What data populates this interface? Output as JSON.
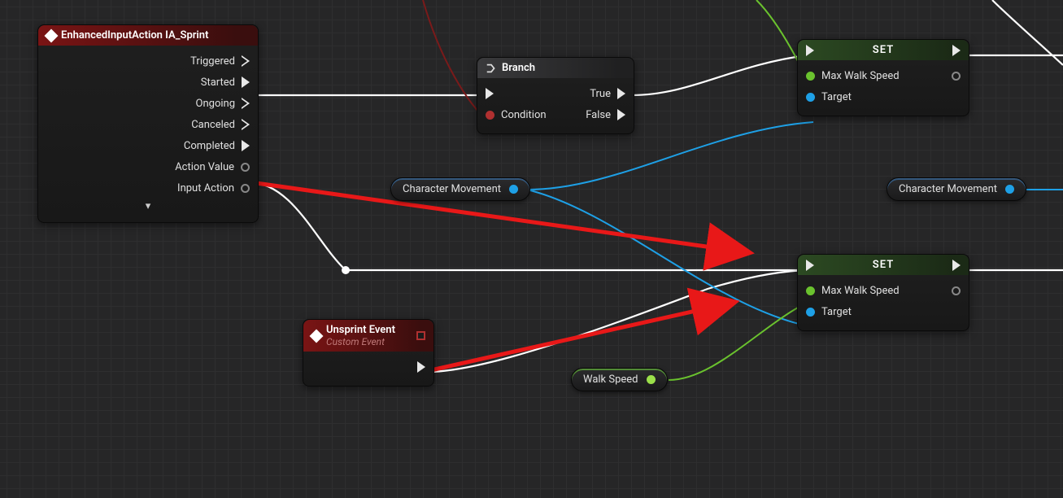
{
  "nodes": {
    "sprint": {
      "title": "EnhancedInputAction IA_Sprint",
      "pins": {
        "triggered": "Triggered",
        "started": "Started",
        "ongoing": "Ongoing",
        "canceled": "Canceled",
        "completed": "Completed",
        "action_value": "Action Value",
        "input_action": "Input Action"
      }
    },
    "branch": {
      "title": "Branch",
      "pins": {
        "condition": "Condition",
        "true": "True",
        "false": "False"
      }
    },
    "unsprint": {
      "title": "Unsprint Event",
      "subtitle": "Custom Event"
    },
    "set1": {
      "title": "SET",
      "pins": {
        "mws": "Max Walk Speed",
        "target": "Target"
      }
    },
    "set2": {
      "title": "SET",
      "pins": {
        "mws": "Max Walk Speed",
        "target": "Target"
      }
    },
    "charmove1": {
      "label": "Character Movement"
    },
    "charmove2": {
      "label": "Character Movement"
    },
    "walkspeed": {
      "label": "Walk Speed"
    }
  }
}
